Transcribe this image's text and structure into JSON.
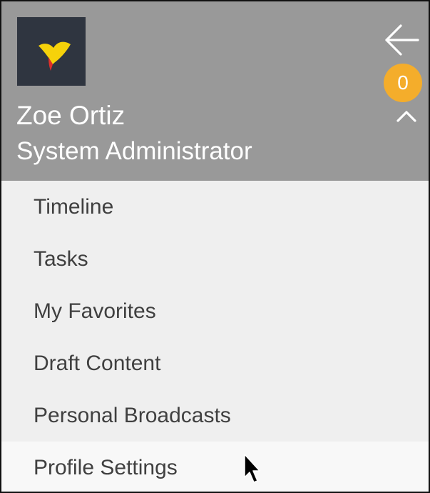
{
  "profile": {
    "name": "Zoe Ortiz",
    "role": "System Administrator",
    "avatar_icon": "yellowfin-logo-icon"
  },
  "header": {
    "back_icon": "arrow-left-icon",
    "collapse_icon": "chevron-up-icon",
    "background_color": "#999999"
  },
  "menu": {
    "items": [
      {
        "label": "Timeline"
      },
      {
        "label": "Tasks",
        "badge": "0"
      },
      {
        "label": "My Favorites"
      },
      {
        "label": "Draft Content"
      },
      {
        "label": "Personal Broadcasts"
      },
      {
        "label": "Profile Settings"
      }
    ],
    "badge_color": "#f4ad2b"
  }
}
